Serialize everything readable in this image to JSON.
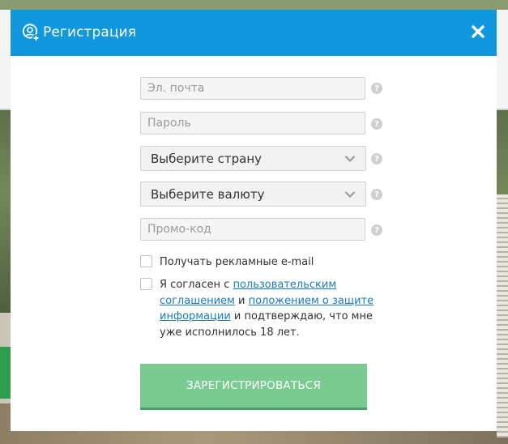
{
  "modal": {
    "title": "Регистрация",
    "icons": {
      "header": "user-add-icon",
      "close": "close-icon",
      "help": "question-icon",
      "chevron": "chevron-down-icon"
    },
    "colors": {
      "header": "#1197dd",
      "button": "#79cb92",
      "link": "#1a7bc0"
    }
  },
  "form": {
    "email_placeholder": "Эл. почта",
    "password_placeholder": "Пароль",
    "country_select": "Выберите страну",
    "currency_select": "Выберите валюту",
    "promo_placeholder": "Промо-код",
    "help_glyph": "?",
    "newsletter_label": "Получать рекламные e-mail",
    "terms": {
      "prefix": "Я согласен с ",
      "link_agreement": "пользовательским соглашением",
      "middle": " и ",
      "link_privacy": "положением о защите информации",
      "suffix": " и подтверждаю, что мне уже исполнилось 18 лет."
    },
    "submit_label": "Зарегистрироваться"
  }
}
